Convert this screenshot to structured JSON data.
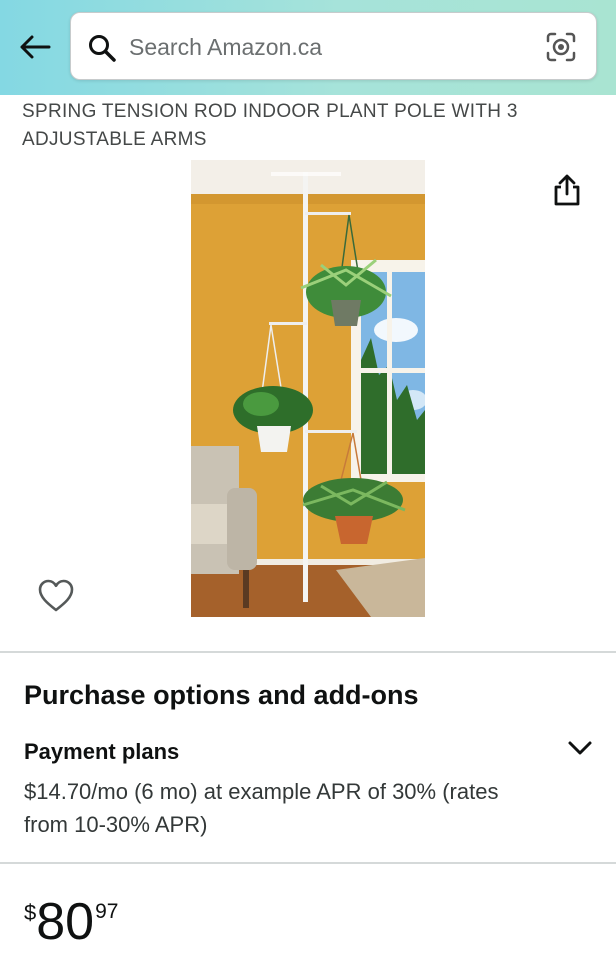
{
  "header": {
    "search_placeholder": "Search Amazon.ca",
    "back_icon": "arrow-left-icon",
    "search_icon": "magnifier-icon",
    "camera_icon": "camera-lens-icon",
    "gradient_colors": [
      "#84d8e3",
      "#a9e4d2"
    ]
  },
  "product": {
    "title": "SPRING TENSION ROD INDOOR PLANT POLE WITH 3 ADJUSTABLE ARMS",
    "share_icon": "share-icon",
    "favorite_icon": "heart-outline-icon"
  },
  "purchase_options": {
    "heading": "Purchase options and add-ons",
    "payment_plans": {
      "label": "Payment plans",
      "description": "$14.70/mo (6 mo) at example APR of 30% (rates from 10-30% APR)",
      "expand_icon": "chevron-down-icon"
    }
  },
  "price": {
    "symbol": "$",
    "whole": "80",
    "fraction": "97"
  }
}
